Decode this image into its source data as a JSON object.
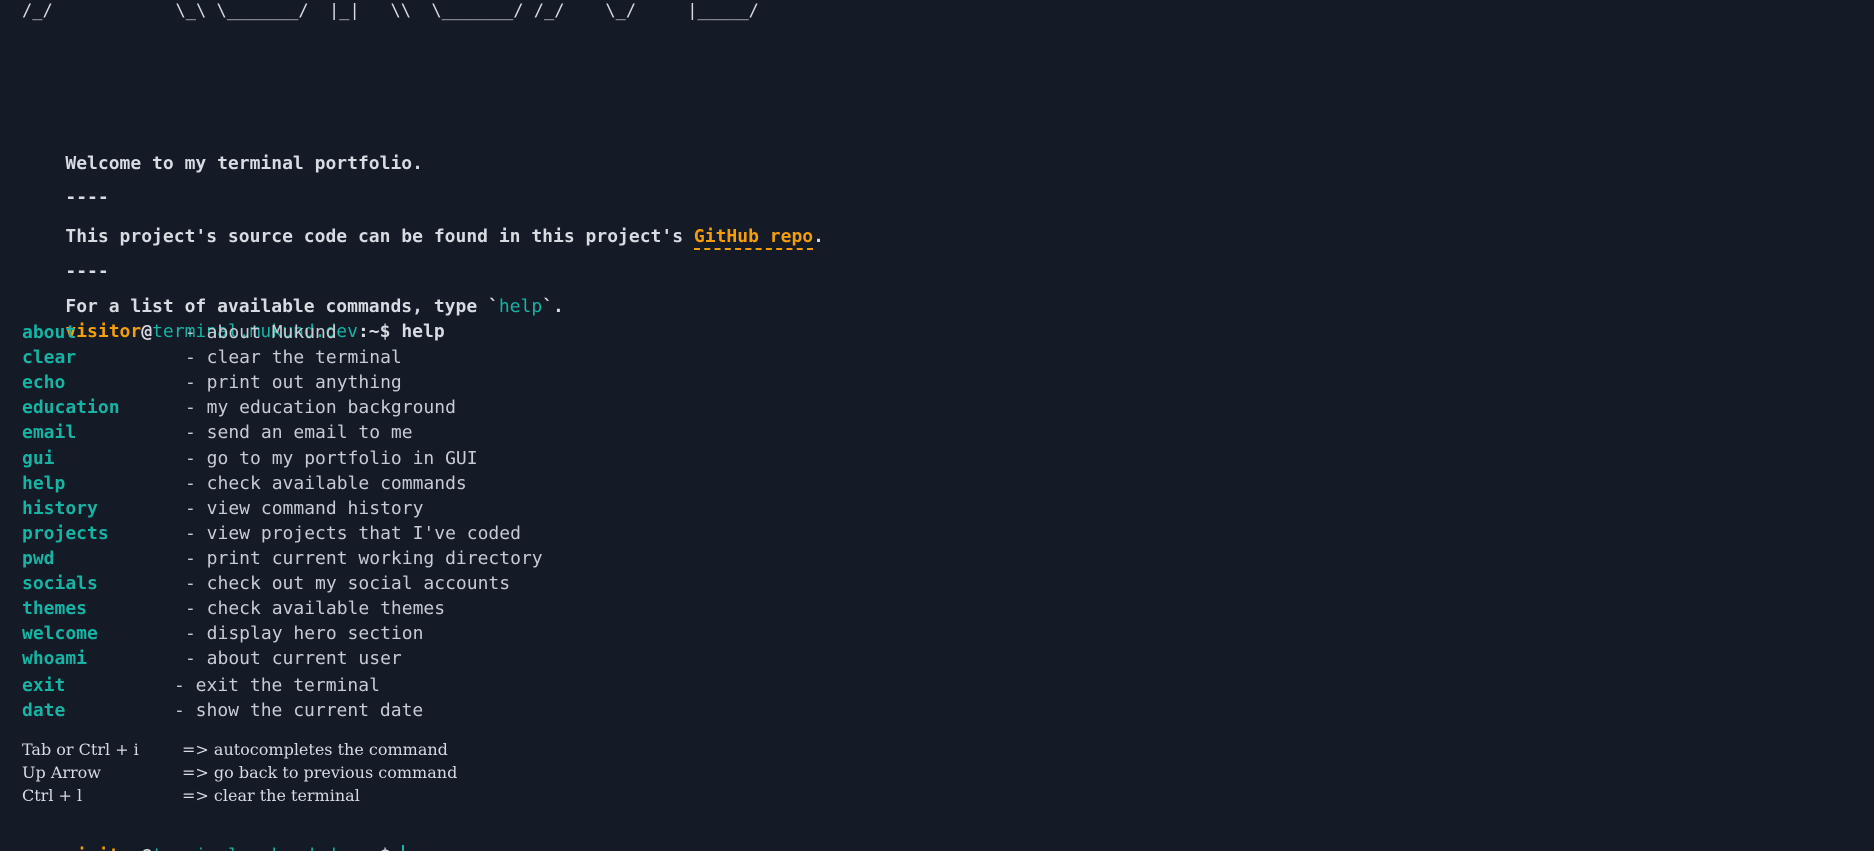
{
  "ascii_banner_last_line": "/_/            \\_\\ \\_______/  |_|   \\\\  \\_______/ /_/    \\_/     |_____/",
  "intro": {
    "welcome": "Welcome to my terminal portfolio.",
    "divider": "----",
    "source_prefix": "This project's source code can be found in this project's ",
    "source_link": "GitHub repo",
    "source_suffix": ".",
    "help_prefix": "For a list of available commands, type `",
    "help_cmd": "help",
    "help_suffix": "`."
  },
  "prompt": {
    "user": "visitor",
    "at": "@",
    "host": "terminal.mukund.dev",
    "symbol": ":~$",
    "last_command": "help"
  },
  "commands": [
    {
      "name": "about",
      "desc": "- about Mukund"
    },
    {
      "name": "clear",
      "desc": "- clear the terminal"
    },
    {
      "name": "echo",
      "desc": "- print out anything"
    },
    {
      "name": "education",
      "desc": "- my education background"
    },
    {
      "name": "email",
      "desc": "- send an email to me"
    },
    {
      "name": "gui",
      "desc": "- go to my portfolio in GUI"
    },
    {
      "name": "help",
      "desc": "- check available commands"
    },
    {
      "name": "history",
      "desc": "- view command history"
    },
    {
      "name": "projects",
      "desc": "- view projects that I've coded"
    },
    {
      "name": "pwd",
      "desc": "- print current working directory"
    },
    {
      "name": "socials",
      "desc": "- check out my social accounts"
    },
    {
      "name": "themes",
      "desc": "- check available themes"
    },
    {
      "name": "welcome",
      "desc": "- display hero section"
    },
    {
      "name": "whoami",
      "desc": "- about current user"
    },
    {
      "name": "exit",
      "desc": "- exit the terminal"
    },
    {
      "name": "date",
      "desc": "- show the current date"
    }
  ],
  "hints": [
    {
      "key": "Tab or Ctrl + i",
      "value": "=> autocompletes the command"
    },
    {
      "key": "Up Arrow",
      "value": "=> go back to previous command"
    },
    {
      "key": "Ctrl + l",
      "value": "=> clear the terminal"
    }
  ],
  "colors": {
    "background": "#141a26",
    "accent_orange": "#f59e0b",
    "accent_cyan": "#17b3a3",
    "text": "#d7dbe2"
  }
}
